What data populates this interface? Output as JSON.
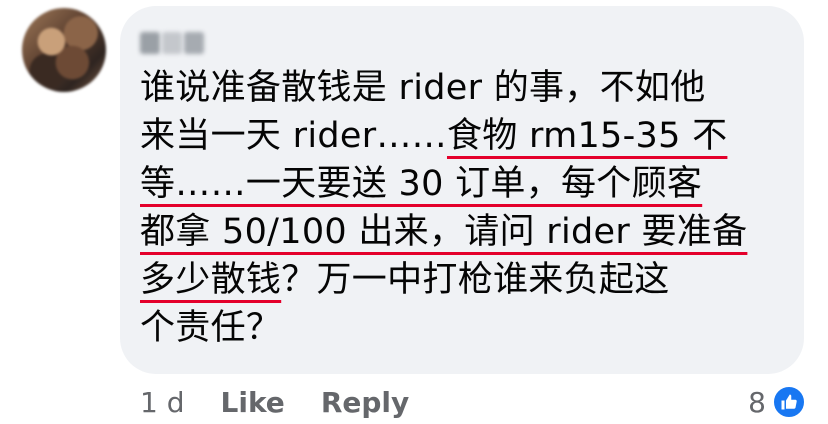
{
  "comment": {
    "lines": [
      [
        {
          "text": "谁说准备散钱是 rider 的事，不如他",
          "underline": false
        }
      ],
      [
        {
          "text": "来当一天 rider……",
          "underline": false
        },
        {
          "text": "食物 rm15-35 不",
          "underline": true
        }
      ],
      [
        {
          "text": "等……一天要送 30 订单，每个顾客",
          "underline": true
        }
      ],
      [
        {
          "text": "都拿 50/100 出来，请问 rider 要准备",
          "underline": true
        }
      ],
      [
        {
          "text": "多少散钱",
          "underline": true
        },
        {
          "text": "？万一中打枪谁来负起这",
          "underline": false
        }
      ],
      [
        {
          "text": "个责任？",
          "underline": false
        }
      ]
    ]
  },
  "actions": {
    "time": "1 d",
    "like_label": "Like",
    "reply_label": "Reply"
  },
  "reactions": {
    "count": "8",
    "icon": "thumbs-up-icon",
    "color": "#1877f2"
  }
}
